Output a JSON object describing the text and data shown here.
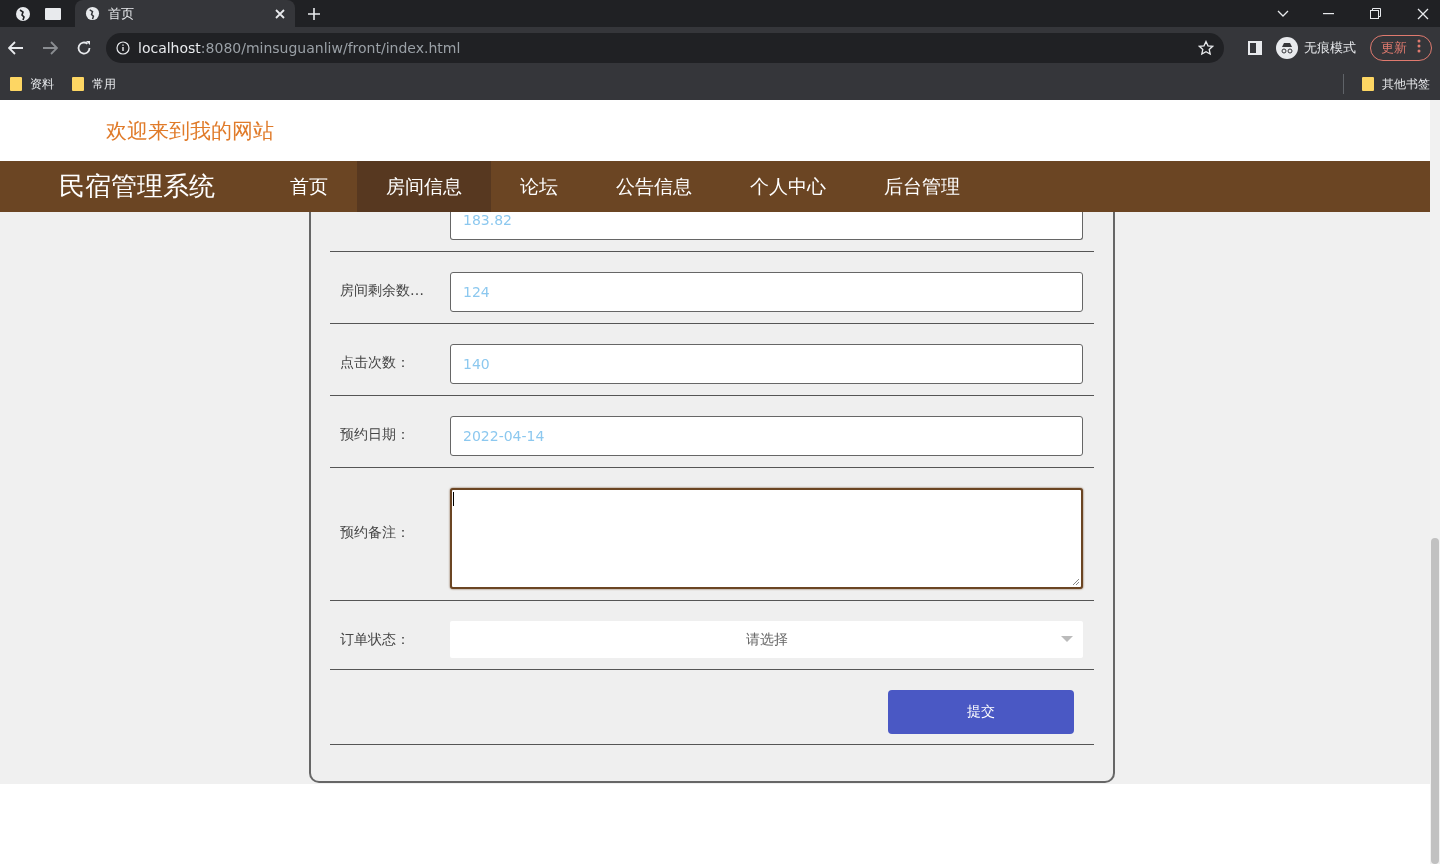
{
  "browser": {
    "tabs": [
      {
        "title": "首页",
        "selected": true
      }
    ],
    "url_host": "localhost",
    "url_path": ":8080/minsuguanliw/front/index.html",
    "incognito": "无痕模式",
    "update": "更新",
    "bookmarks": [
      "资料",
      "常用"
    ],
    "other_bookmarks": "其他书签"
  },
  "header": {
    "welcome": "欢迎来到我的网站"
  },
  "nav": {
    "brand": "民宿管理系统",
    "items": [
      {
        "label": "首页",
        "selected": false
      },
      {
        "label": "房间信息",
        "selected": true
      },
      {
        "label": "论坛",
        "selected": false
      },
      {
        "label": "公告信息",
        "selected": false
      },
      {
        "label": "个人中心",
        "selected": false
      },
      {
        "label": "后台管理",
        "selected": false
      }
    ]
  },
  "form": {
    "rows": [
      {
        "kind": "partial",
        "value": "183.82"
      },
      {
        "kind": "input",
        "label": "房间剩余数…",
        "value": "124"
      },
      {
        "kind": "input",
        "label": "点击次数：",
        "value": "140"
      },
      {
        "kind": "input",
        "label": "预约日期：",
        "value": "2022-04-14"
      },
      {
        "kind": "textarea",
        "label": "预约备注：",
        "focused": true
      },
      {
        "kind": "select",
        "label": "订单状态：",
        "placeholder": "请选择"
      },
      {
        "kind": "button",
        "label": "提交"
      }
    ]
  }
}
